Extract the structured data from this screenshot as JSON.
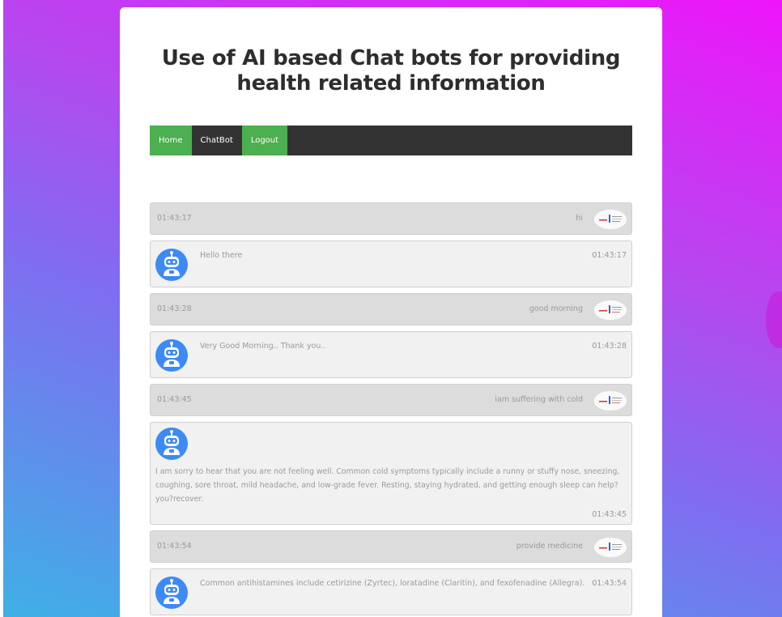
{
  "page": {
    "title_line1": "Use of AI based Chat bots for providing",
    "title_line2": "health related information"
  },
  "nav": {
    "items": [
      {
        "label": "Home",
        "active": true
      },
      {
        "label": "ChatBot",
        "active": false
      },
      {
        "label": "Logout",
        "active": true
      }
    ]
  },
  "chat": {
    "messages": [
      {
        "sender": "user",
        "time": "01:43:17",
        "text": "hi"
      },
      {
        "sender": "bot",
        "time": "01:43:17",
        "text": "Hello there"
      },
      {
        "sender": "user",
        "time": "01:43:28",
        "text": "good morning"
      },
      {
        "sender": "bot",
        "time": "01:43:28",
        "text": "Very Good Morning.. Thank you.."
      },
      {
        "sender": "user",
        "time": "01:43:45",
        "text": "iam suffering with cold"
      },
      {
        "sender": "bot",
        "time": "01:43:45",
        "text": "I am sorry to hear that you are not feeling well. Common cold symptoms typically include a runny or stuffy nose, sneezing, coughing, sore throat, mild headache, and low-grade fever. Resting, staying hydrated, and getting enough sleep can help? you?recover."
      },
      {
        "sender": "user",
        "time": "01:43:54",
        "text": "provide medicine"
      },
      {
        "sender": "bot",
        "time": "01:43:54",
        "text": "Common antihistamines include cetirizine (Zyrtec), loratadine (Claritin), and fexofenadine (Allegra)."
      }
    ]
  },
  "colors": {
    "nav_active": "#4caf50",
    "nav_bg": "#333333",
    "bot_avatar": "#3d8af7"
  },
  "icons": {
    "bot_avatar": "robot-icon",
    "user_avatar": "user-image"
  }
}
